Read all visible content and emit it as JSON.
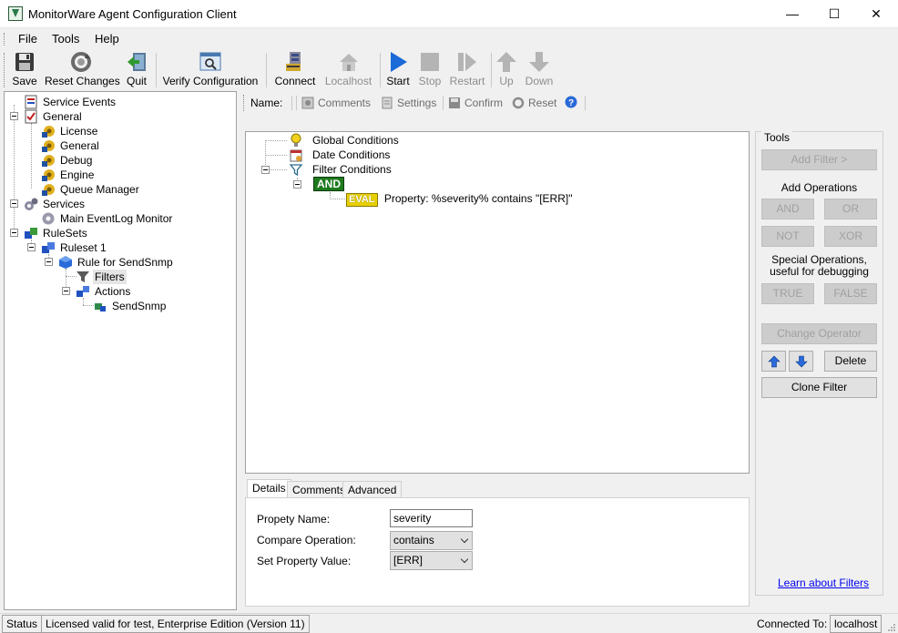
{
  "window": {
    "title": "MonitorWare Agent Configuration Client",
    "minimize": "—",
    "maximize": "☐",
    "close": "✕"
  },
  "menu": {
    "file": "File",
    "tools": "Tools",
    "help": "Help"
  },
  "toolbar": {
    "save": "Save",
    "reset_changes": "Reset Changes",
    "quit": "Quit",
    "verify": "Verify Configuration",
    "connect": "Connect",
    "localhost": "Localhost",
    "start": "Start",
    "stop": "Stop",
    "restart": "Restart",
    "up": "Up",
    "down": "Down"
  },
  "tree": {
    "service_events": "Service Events",
    "general": "General",
    "license": "License",
    "general_child": "General",
    "debug": "Debug",
    "engine": "Engine",
    "queue_manager": "Queue Manager",
    "services": "Services",
    "main_eventlog_monitor": "Main EventLog Monitor",
    "rulesets": "RuleSets",
    "ruleset1": "Ruleset 1",
    "rule_for_sendsnmp": "Rule for SendSnmp",
    "filters": "Filters",
    "actions": "Actions",
    "sendsnmp": "SendSnmp"
  },
  "subbar": {
    "name": "Name:",
    "comments": "Comments",
    "settings": "Settings",
    "confirm": "Confirm",
    "reset": "Reset"
  },
  "filter_tree": {
    "global_conditions": "Global Conditions",
    "date_conditions": "Date Conditions",
    "filter_conditions": "Filter Conditions",
    "and": "AND",
    "eval": "EVAL",
    "eval_text": "Property: %severity% contains \"[ERR]\""
  },
  "tabs": {
    "details": "Details",
    "comments": "Comments",
    "advanced": "Advanced"
  },
  "details": {
    "property_name_label": "Propety Name:",
    "property_name_value": "severity",
    "compare_label": "Compare Operation:",
    "compare_value": "contains",
    "set_value_label": "Set Property Value:",
    "set_value_value": "[ERR]"
  },
  "tools": {
    "title": "Tools",
    "add_filter": "Add Filter >",
    "add_operations": "Add Operations",
    "and": "AND",
    "or": "OR",
    "not": "NOT",
    "xor": "XOR",
    "special_line1": "Special Operations,",
    "special_line2": "useful for debugging",
    "true": "TRUE",
    "false": "FALSE",
    "change_operator": "Change Operator",
    "delete": "Delete",
    "clone_filter": "Clone Filter",
    "learn": "Learn about Filters"
  },
  "status": {
    "status": "Status",
    "license": "Licensed valid for test, Enterprise Edition (Version 11)",
    "connected_to": "Connected To:",
    "host": "localhost"
  }
}
